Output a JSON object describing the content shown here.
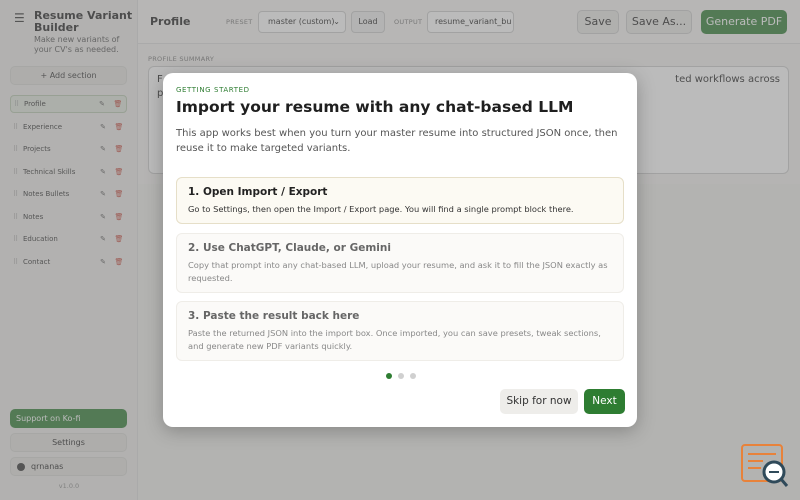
{
  "app": {
    "title": "Resume Variant Builder",
    "subtitle": "Make new variants of your CV's as needed.",
    "version": "v1.0.0"
  },
  "sidebar": {
    "add_section_label": "+ Add section",
    "sections": [
      {
        "label": "Profile",
        "active": true
      },
      {
        "label": "Experience",
        "active": false
      },
      {
        "label": "Projects",
        "active": false
      },
      {
        "label": "Technical Skills",
        "active": false
      },
      {
        "label": "Notes Bullets",
        "active": false
      },
      {
        "label": "Notes",
        "active": false
      },
      {
        "label": "Education",
        "active": false
      },
      {
        "label": "Contact",
        "active": false
      }
    ],
    "kofi_label": "Support on Ko-fi",
    "settings_label": "Settings",
    "github_label": "qrnanas"
  },
  "topbar": {
    "page_title": "Profile",
    "preset_label": "PRESET",
    "preset_value": "master (custom)",
    "load_label": "Load",
    "output_label": "OUTPUT",
    "output_value": "resume_variant_bu",
    "save_label": "Save",
    "save_as_label": "Save As...",
    "generate_label": "Generate PDF"
  },
  "main": {
    "summary_label": "PROFILE SUMMARY",
    "summary_visible_start": "F",
    "summary_visible_start_line2": "p",
    "summary_visible_end": "ted workflows across"
  },
  "modal": {
    "eyebrow": "GETTING STARTED",
    "title": "Import your resume with any chat-based LLM",
    "intro": "This app works best when you turn your master resume into structured JSON once, then reuse it to make targeted variants.",
    "steps": [
      {
        "title": "1. Open Import / Export",
        "desc": "Go to Settings, then open the Import / Export page. You will find a single prompt block there.",
        "active": true
      },
      {
        "title": "2. Use ChatGPT, Claude, or Gemini",
        "desc": "Copy that prompt into any chat-based LLM, upload your resume, and ask it to fill the JSON exactly as requested.",
        "active": false
      },
      {
        "title": "3. Paste the result back here",
        "desc": "Paste the returned JSON into the import box. Once imported, you can save presets, tweak sections, and generate new PDF variants quickly.",
        "active": false
      }
    ],
    "current_step": 1,
    "total_steps": 3,
    "skip_label": "Skip for now",
    "next_label": "Next"
  },
  "colors": {
    "accent": "#2e7d32",
    "danger": "#c0392b",
    "corner_logo": "#e8823a"
  }
}
